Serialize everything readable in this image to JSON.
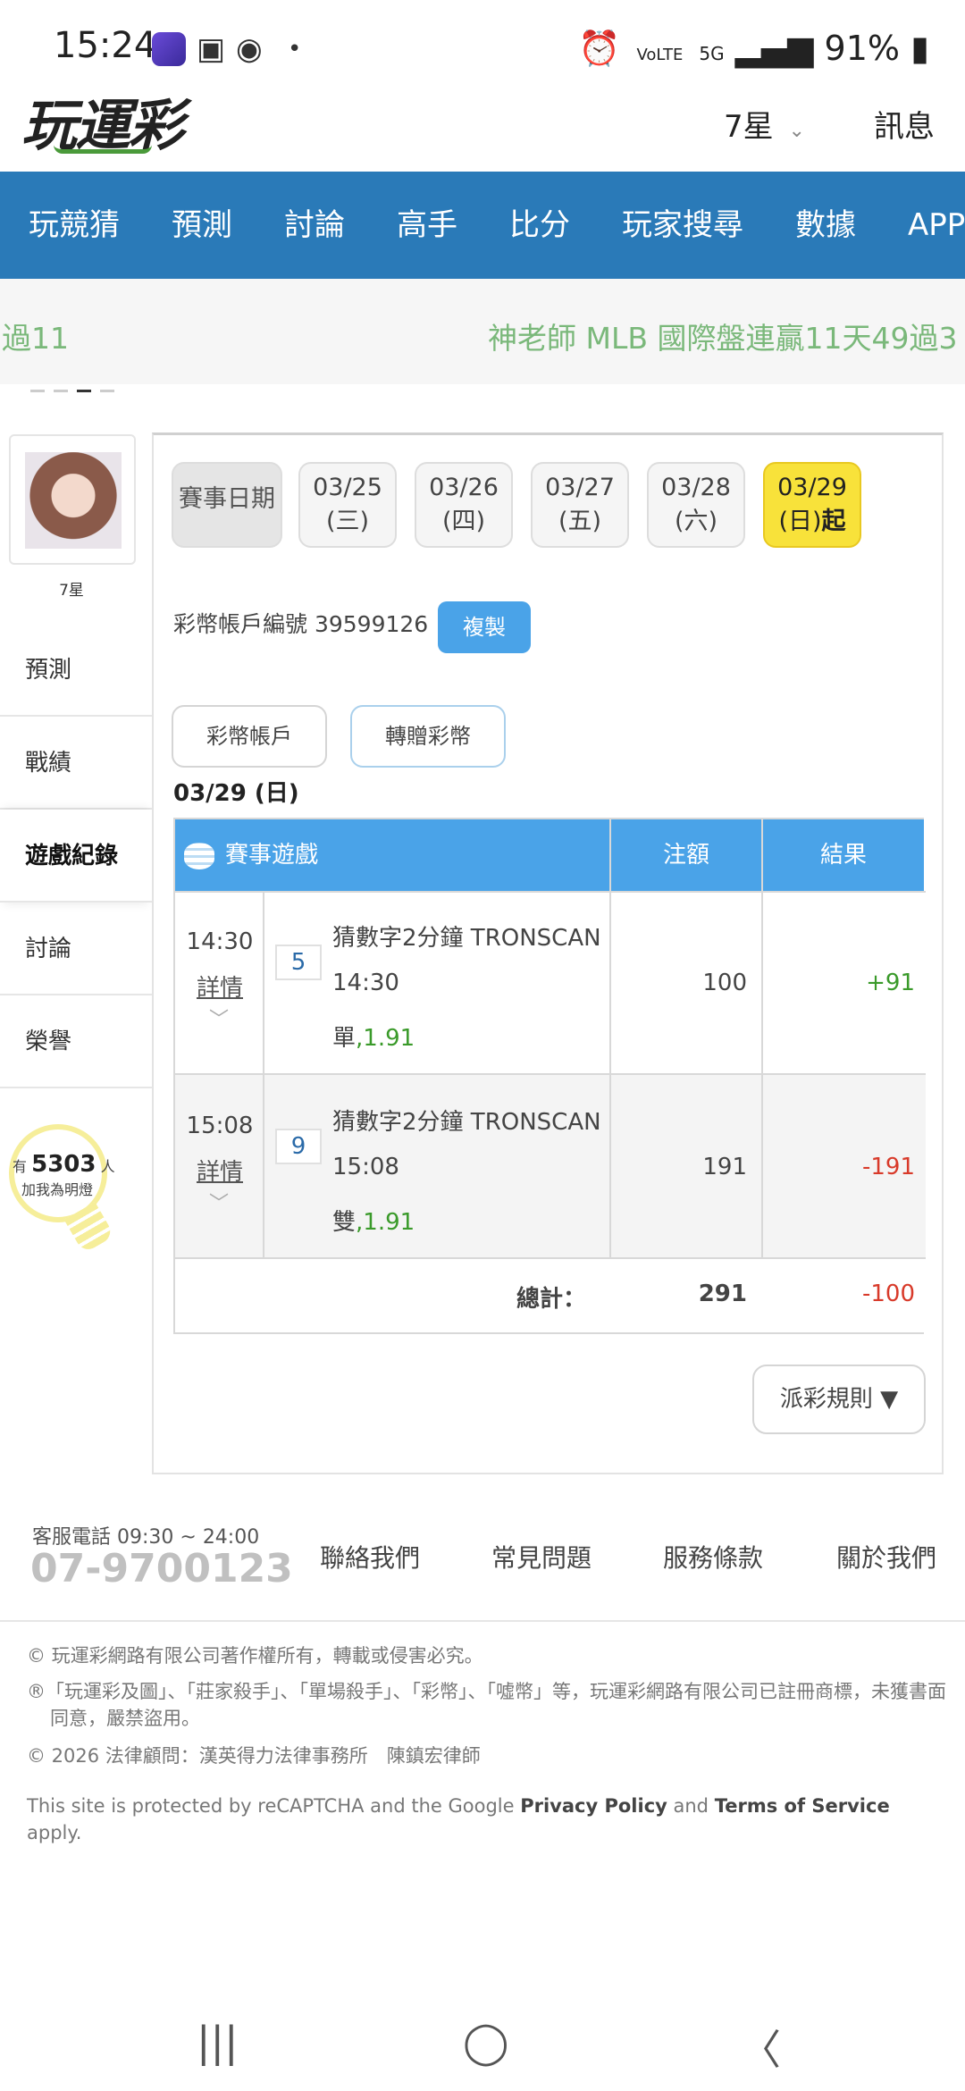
{
  "status_bar": {
    "time": "15:24",
    "app_badge": "ONLINE",
    "dot": "•",
    "battery": "91%",
    "network": "5G",
    "volte": "VoLTE"
  },
  "header": {
    "logo": "玩運彩",
    "lottery": "7星",
    "messages": "訊息"
  },
  "main_nav": [
    "玩競猜",
    "預測",
    "討論",
    "高手",
    "比分",
    "玩家搜尋",
    "數據",
    "APP"
  ],
  "ticker": {
    "left": "過11",
    "right": "神老師 MLB 國際盤連贏11天49過3"
  },
  "profile": {
    "name": "7星",
    "menu": [
      "預測",
      "戰績",
      "遊戲紀錄",
      "討論",
      "榮譽"
    ],
    "active": "遊戲紀錄"
  },
  "witness": {
    "prefix": "有",
    "count": "5303",
    "suffix": "人",
    "line2": "加我為明燈"
  },
  "date_tabs": {
    "label": "賽事日期",
    "dates": [
      {
        "date": "03/25",
        "day": "(三)"
      },
      {
        "date": "03/26",
        "day": "(四)"
      },
      {
        "date": "03/27",
        "day": "(五)"
      },
      {
        "date": "03/28",
        "day": "(六)"
      },
      {
        "date": "03/29",
        "day": "(日)",
        "suffix": "起",
        "selected": true
      }
    ]
  },
  "account": {
    "label": "彩幣帳戶編號 39599126",
    "copy_button": "複製"
  },
  "account_tabs": [
    "彩幣帳戶",
    "轉贈彩幣"
  ],
  "date_heading": "03/29 (日)",
  "table": {
    "headers": {
      "game": "賽事遊戲",
      "stake": "注額",
      "result": "結果"
    },
    "rows": [
      {
        "time": "14:30",
        "detail": "詳情",
        "number": "5",
        "title": "猜數字2分鐘 TRONSCAN",
        "time2": "14:30",
        "pick": "單",
        "odds": ",1.91",
        "stake": "100",
        "result": "+91",
        "result_color": "#3a9a2a"
      },
      {
        "time": "15:08",
        "detail": "詳情",
        "number": "9",
        "title": "猜數字2分鐘 TRONSCAN",
        "time2": "15:08",
        "pick": "雙",
        "odds": ",1.91",
        "stake": "191",
        "result": "-191",
        "result_color": "#d83a2a"
      }
    ],
    "total_label": "總計：",
    "total_stake": "291",
    "total_result": "-100"
  },
  "payout_rules_button": "派彩規則 ▼",
  "footer": {
    "cs_label": "客服電話 09:30 ~ 24:00",
    "cs_phone": "07-9700123",
    "links": [
      "聯絡我們",
      "常見問題",
      "服務條款",
      "關於我們"
    ],
    "copyright": "© 玩運彩網路有限公司著作權所有，轉載或侵害必究。",
    "trademark": "®「玩運彩及圖」、「莊家殺手」、「單場殺手」、「彩幣」、「噓幣」等，玩運彩網路有限公司已註冊商標，未獲書面同意，嚴禁盜用。",
    "legal": "© 2026 法律顧問：漢英得力法律事務所　陳鎮宏律師",
    "recaptcha_prefix": "This site is protected by reCAPTCHA and the Google ",
    "privacy": "Privacy Policy",
    "and": " and ",
    "terms": "Terms of Service",
    "apply": " apply."
  },
  "nav_bar": {
    "recents": "|||",
    "home": "◯",
    "back": "〈"
  }
}
